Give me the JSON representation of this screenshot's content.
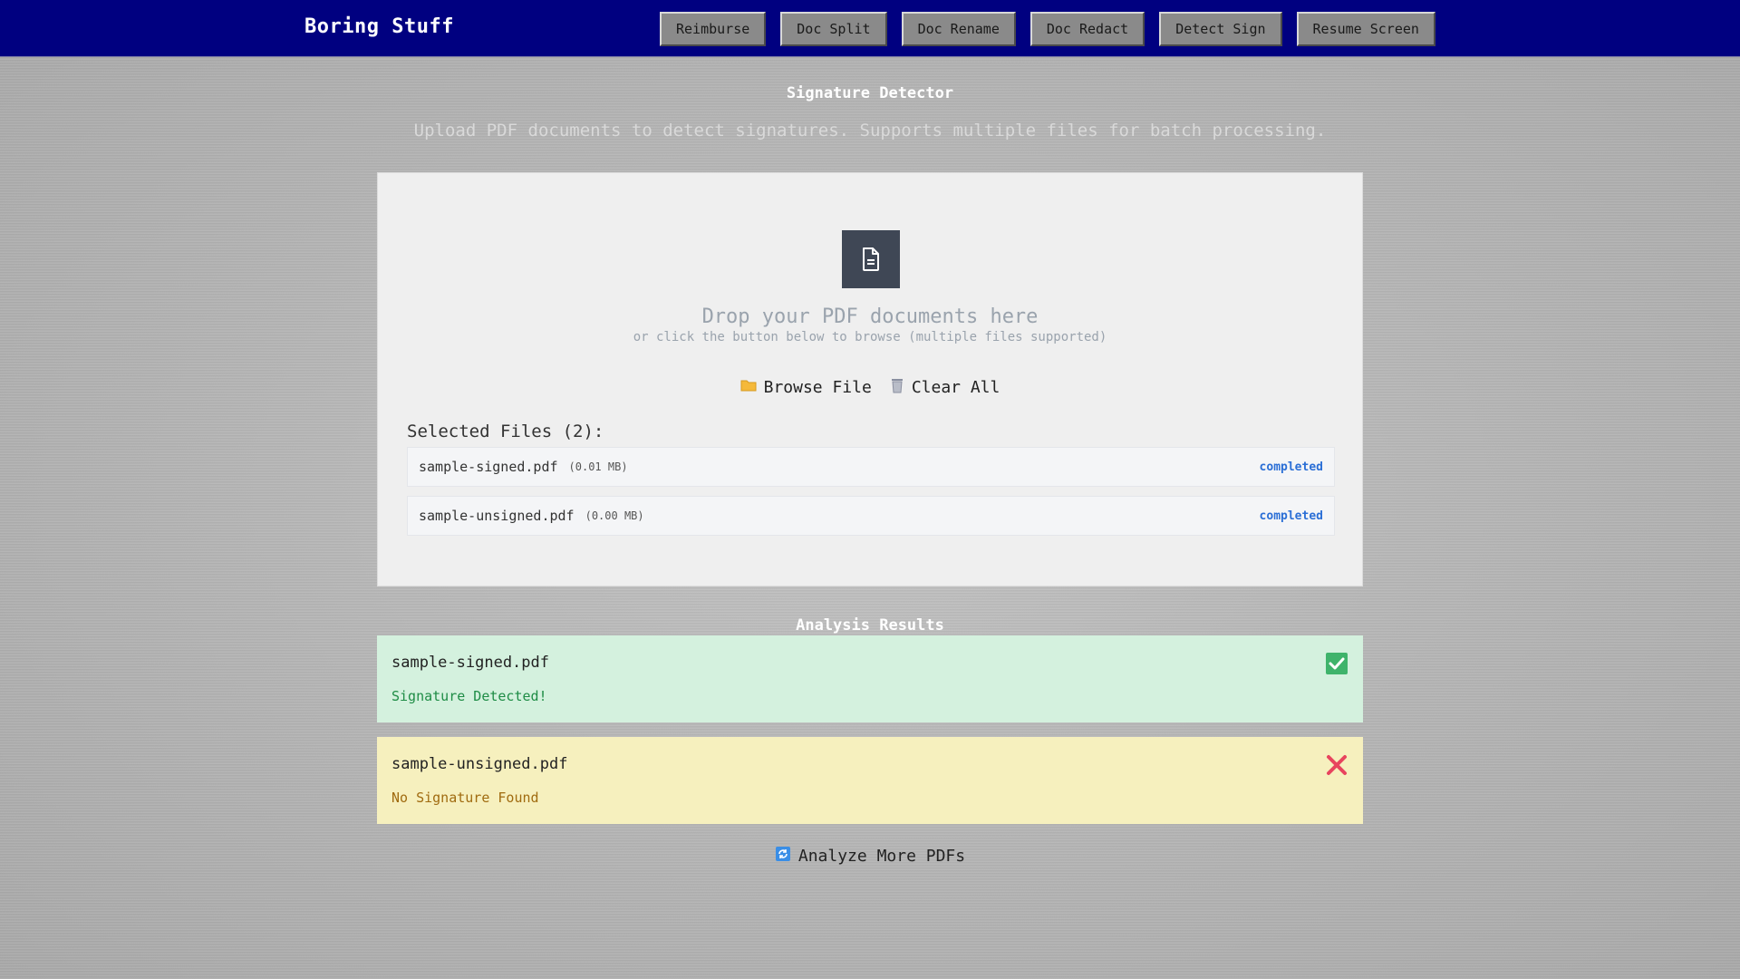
{
  "header": {
    "brand": "Boring Stuff",
    "nav": [
      "Reimburse",
      "Doc Split",
      "Doc Rename",
      "Doc Redact",
      "Detect Sign",
      "Resume Screen"
    ]
  },
  "page": {
    "title": "Signature Detector",
    "subtitle": "Upload PDF documents to detect signatures. Supports multiple files for batch processing."
  },
  "upload": {
    "drop_title": "Drop your PDF documents here",
    "drop_subtitle": "or click the button below to browse (multiple files supported)",
    "browse_label": "Browse File",
    "clear_label": "Clear All",
    "selected_title": "Selected Files (2):",
    "files": [
      {
        "name": "sample-signed.pdf",
        "size": "(0.01 MB)",
        "status": "completed"
      },
      {
        "name": "sample-unsigned.pdf",
        "size": "(0.00 MB)",
        "status": "completed"
      }
    ]
  },
  "results": {
    "title": "Analysis Results",
    "items": [
      {
        "file": "sample-signed.pdf",
        "message": "Signature Detected!",
        "icon": "check-icon"
      },
      {
        "file": "sample-unsigned.pdf",
        "message": "No Signature Found",
        "icon": "cross-icon"
      }
    ],
    "analyze_more_label": "Analyze More PDFs"
  },
  "colors": {
    "header_bg": "#000080",
    "success_bg": "#d4f1de",
    "warning_bg": "#f6f0be",
    "status_link": "#2b6fd6"
  }
}
